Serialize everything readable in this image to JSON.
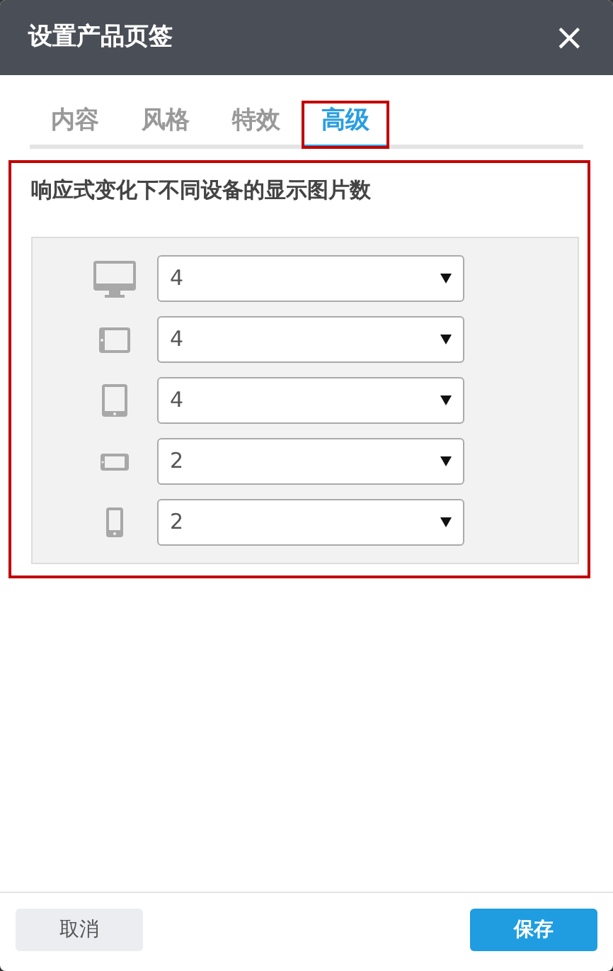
{
  "window": {
    "title": "设置产品页签",
    "close": "×"
  },
  "tabs": [
    {
      "label": "内容",
      "selected": false,
      "highlighted": false
    },
    {
      "label": "风格",
      "selected": false,
      "highlighted": false
    },
    {
      "label": "特效",
      "selected": false,
      "highlighted": false
    },
    {
      "label": "高级",
      "selected": true,
      "highlighted": true
    }
  ],
  "section": {
    "title": "响应式变化下不同设备的显示图片数",
    "highlighted": true,
    "devices": [
      {
        "kind": "desktop",
        "value": "4"
      },
      {
        "kind": "tablet-landscape",
        "value": "4"
      },
      {
        "kind": "tablet",
        "value": "4"
      },
      {
        "kind": "phone-landscape",
        "value": "2"
      },
      {
        "kind": "phone",
        "value": "2"
      }
    ]
  },
  "buttons": [
    {
      "label": "取消",
      "kind": "secondary"
    },
    {
      "label": "保存",
      "kind": "primary"
    }
  ]
}
